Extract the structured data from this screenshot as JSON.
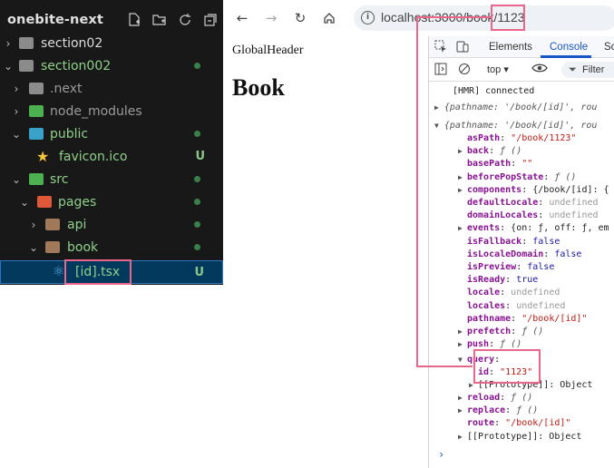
{
  "explorer": {
    "title": "onebite-next",
    "header_icons": [
      "new-file-icon",
      "new-folder-icon",
      "refresh-icon",
      "collapse-icon"
    ],
    "items": [
      {
        "label": "section02",
        "icon": "folder-icon",
        "expanded": false
      },
      {
        "label": "section002",
        "icon": "folder-icon",
        "expanded": true
      },
      {
        "label": ".next",
        "icon": "folder-icon",
        "expanded": false
      },
      {
        "label": "node_modules",
        "icon": "folder-icon",
        "expanded": false
      },
      {
        "label": "public",
        "icon": "globe-folder-icon",
        "expanded": true
      },
      {
        "label": "favicon.ico",
        "icon": "star-icon",
        "badge": "U"
      },
      {
        "label": "src",
        "icon": "code-folder-icon",
        "expanded": true
      },
      {
        "label": "pages",
        "icon": "pages-folder-icon",
        "expanded": true
      },
      {
        "label": "api",
        "icon": "folder-icon",
        "expanded": false
      },
      {
        "label": "book",
        "icon": "folder-icon",
        "expanded": true
      },
      {
        "label": "[id].tsx",
        "icon": "react-icon",
        "badge": "U"
      }
    ]
  },
  "browser": {
    "url": "localhost:3000/book/1123",
    "url_prefix": "localhost:3000/book",
    "url_highlight": "/1123",
    "page": {
      "global_header": "GlobalHeader",
      "heading": "Book"
    },
    "devtools": {
      "tabs": [
        "Elements",
        "Console",
        "Sc"
      ],
      "active_tab": "Console",
      "context": "top",
      "filter_label": "Filter",
      "console": {
        "hmr": "[HMR] connected",
        "collapsed_log": "{pathname: '/book/[id]', rou",
        "expanded_log": "{pathname: '/book/[id]', rou",
        "props": [
          {
            "key": "asPath",
            "value": "\"/book/1123\"",
            "kind": "string"
          },
          {
            "key": "back",
            "value": "ƒ ()",
            "kind": "func",
            "arrow": true
          },
          {
            "key": "basePath",
            "value": "\"\"",
            "kind": "string"
          },
          {
            "key": "beforePopState",
            "value": "ƒ ()",
            "kind": "func",
            "arrow": true
          },
          {
            "key": "components",
            "value": "{/book/[id]: {",
            "kind": "obj",
            "arrow": true
          },
          {
            "key": "defaultLocale",
            "value": "undefined",
            "kind": "undef"
          },
          {
            "key": "domainLocales",
            "value": "undefined",
            "kind": "undef"
          },
          {
            "key": "events",
            "value": "{on: ƒ, off: ƒ, em",
            "kind": "obj",
            "arrow": true
          },
          {
            "key": "isFallback",
            "value": "false",
            "kind": "bool"
          },
          {
            "key": "isLocaleDomain",
            "value": "false",
            "kind": "bool"
          },
          {
            "key": "isPreview",
            "value": "false",
            "kind": "bool"
          },
          {
            "key": "isReady",
            "value": "true",
            "kind": "bool"
          },
          {
            "key": "locale",
            "value": "undefined",
            "kind": "undef"
          },
          {
            "key": "locales",
            "value": "undefined",
            "kind": "undef"
          },
          {
            "key": "pathname",
            "value": "\"/book/[id]\"",
            "kind": "string"
          },
          {
            "key": "prefetch",
            "value": "ƒ ()",
            "kind": "func",
            "arrow": true
          },
          {
            "key": "push",
            "value": "ƒ ()",
            "kind": "func",
            "arrow": true
          }
        ],
        "query_key": "query",
        "query_id_key": "id",
        "query_id_value": "\"1123\"",
        "prototype_inner": "[[Prototype]]: Object",
        "tail_props": [
          {
            "key": "reload",
            "value": "ƒ ()",
            "kind": "func",
            "arrow": true
          },
          {
            "key": "replace",
            "value": "ƒ ()",
            "kind": "func",
            "arrow": true
          },
          {
            "key": "route",
            "value": "\"/book/[id]\"",
            "kind": "string"
          }
        ],
        "prototype_outer": "[[Prototype]]: Object"
      }
    }
  },
  "colors": {
    "highlight": "#e8678a",
    "sidebar_bg": "#181818",
    "selected_bg": "#04395e",
    "console_key": "#881391",
    "console_string": "#c41a16",
    "console_bool": "#1a1aa6"
  }
}
